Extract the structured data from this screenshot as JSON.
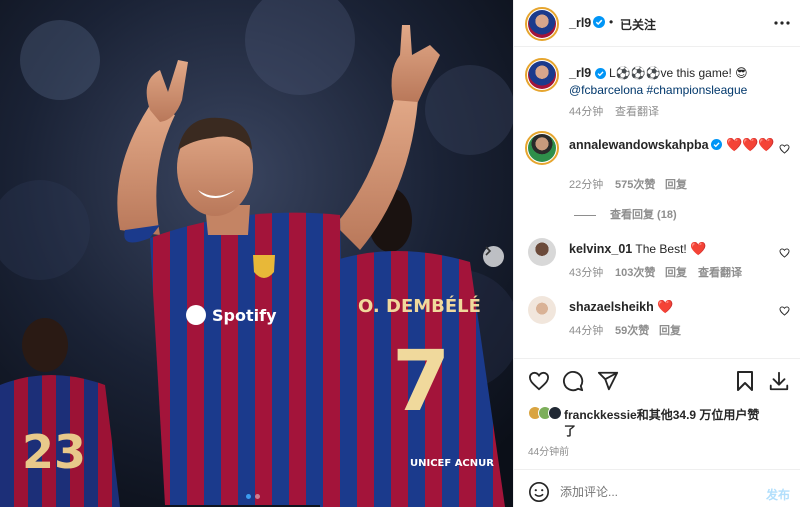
{
  "header": {
    "username": "_rl9",
    "separator": "•",
    "follow_status": "已关注",
    "more_icon": "ellipsis-icon"
  },
  "caption": {
    "username": "_rl9",
    "text_prefix": "L",
    "text_suffix": "ve this game!",
    "mentions": "@fcbarcelona #championsleague",
    "time": "44分钟",
    "translate": "查看翻译"
  },
  "comments": [
    {
      "username": "annalewandowskahpba",
      "text": "",
      "hearts": "❤️❤️❤️",
      "time": "22分钟",
      "likes": "575次赞",
      "reply": "回复",
      "view_replies": "查看回复 (18)"
    },
    {
      "username": "kelvinx_01",
      "text": "The Best!",
      "hearts": "❤️",
      "time": "43分钟",
      "likes": "103次赞",
      "reply": "回复",
      "translate": "查看翻译"
    },
    {
      "username": "shazaelsheikh",
      "text": "",
      "hearts": "❤️",
      "time": "44分钟",
      "likes": "59次赞",
      "reply": "回复"
    }
  ],
  "actions": {
    "like_icon": "heart-icon",
    "comment_icon": "comment-icon",
    "share_icon": "send-icon",
    "save_icon": "bookmark-icon",
    "download_icon": "download-icon"
  },
  "likes_summary": {
    "username": "franckkessie",
    "text_line1": "和其他34.9 万位用户赞",
    "text_line2": "了"
  },
  "post_time": "44分钟前",
  "add_comment": {
    "emoji_icon": "smiley-icon",
    "placeholder": "添加评论...",
    "submit": "发布"
  },
  "photo": {
    "jersey_text_sponsor": "Spotify",
    "jersey_back_name": "O. DEMBÉLÉ",
    "jersey_back_number": "7",
    "jersey_left_number": "23",
    "jersey_back_sponsor": "UNICEF ACNUR"
  },
  "carousel": {
    "next_icon": "chevron-right-icon",
    "page": 1,
    "total": 2
  },
  "colors": {
    "accent_blue": "#0095f6",
    "heart_red": "#ed4956",
    "barca_blue": "#1b3f8f",
    "barca_garnet": "#a50044"
  }
}
